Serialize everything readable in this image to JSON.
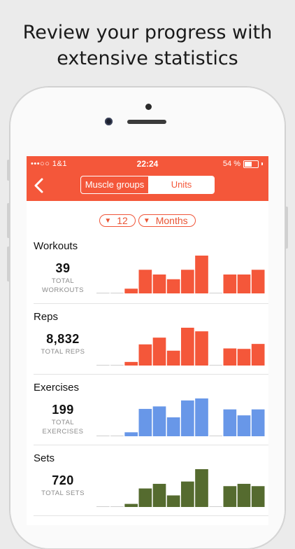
{
  "headline": [
    "Review your progress with",
    "extensive statistics"
  ],
  "status_bar": {
    "carrier": "•••○○ 1&1",
    "time": "22:24",
    "battery": "54 %",
    "battery_level": 0.54
  },
  "nav": {
    "segments": [
      "Muscle groups",
      "Units"
    ],
    "selected_segment": "Units"
  },
  "filters": {
    "count": "12",
    "period": "Months",
    "dropdown_glyph": "▼"
  },
  "sections": [
    {
      "title": "Workouts",
      "value": "39",
      "sub": "TOTAL WORKOUTS",
      "color": "#f4573a",
      "bars": [
        0,
        0,
        2,
        10,
        8,
        6,
        10,
        16,
        0,
        8,
        8,
        10
      ]
    },
    {
      "title": "Reps",
      "value": "8,832",
      "sub": "TOTAL REPS",
      "color": "#f4573a",
      "bars": [
        0,
        0,
        80,
        470,
        620,
        330,
        840,
        760,
        0,
        380,
        370,
        480
      ]
    },
    {
      "title": "Exercises",
      "value": "199",
      "sub": "TOTAL EXERCISES",
      "color": "#6897e8",
      "bars": [
        0,
        0,
        8,
        55,
        60,
        38,
        72,
        76,
        0,
        54,
        42,
        54
      ]
    },
    {
      "title": "Sets",
      "value": "720",
      "sub": "TOTAL SETS",
      "color": "#556b2f",
      "bars": [
        0,
        0,
        20,
        120,
        150,
        75,
        165,
        245,
        0,
        135,
        150,
        135
      ]
    }
  ]
}
